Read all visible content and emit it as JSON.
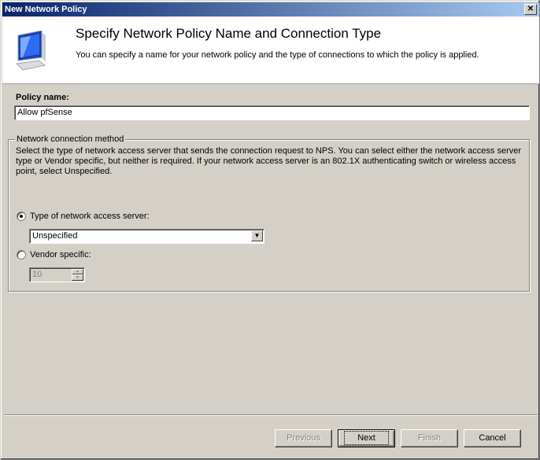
{
  "window": {
    "title": "New Network Policy",
    "close_icon": "close-icon"
  },
  "header": {
    "title": "Specify Network Policy Name and Connection Type",
    "subtitle": "You can specify a name for your network policy and the type of connections to which the policy is applied.",
    "icon": "network-computer-icon"
  },
  "policy_name": {
    "label": "Policy name:",
    "value": "Allow pfSense"
  },
  "connection_method": {
    "legend": "Network connection method",
    "description": "Select the type of network access server that sends the connection request to NPS. You can select either the network access server type or Vendor specific, but neither is required.  If your network access server is an 802.1X authenticating switch or wireless access point, select Unspecified.",
    "type_radio": {
      "label": "Type of network access server:",
      "checked": true
    },
    "type_select": {
      "value": "Unspecified"
    },
    "vendor_radio": {
      "label": "Vendor specific:",
      "checked": false
    },
    "vendor_spinner": {
      "value": "10",
      "disabled": true
    }
  },
  "buttons": {
    "previous": "Previous",
    "next": "Next",
    "finish": "Finish",
    "cancel": "Cancel"
  }
}
